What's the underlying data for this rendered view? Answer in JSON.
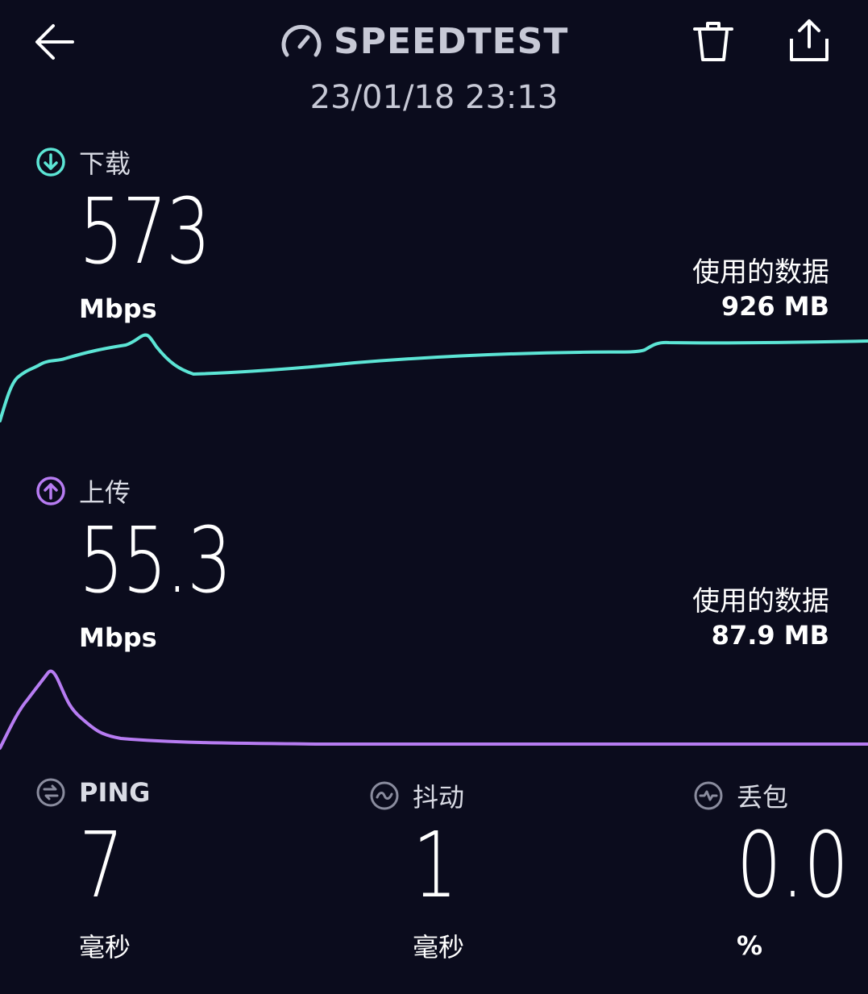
{
  "header": {
    "brand": "SPEEDTEST",
    "datetime": "23/01/18 23:13",
    "icons": {
      "back": "arrow-left-icon",
      "brand": "speedometer-icon",
      "delete": "trash-icon",
      "share": "share-icon"
    }
  },
  "download": {
    "label": "下载",
    "value": "573",
    "unit": "Mbps",
    "data_used_label": "使用的数据",
    "data_used_value": "926 MB",
    "color": "#5ce5d5",
    "icon": "arrow-down-circle-icon"
  },
  "upload": {
    "label": "上传",
    "value": "55.3",
    "unit": "Mbps",
    "data_used_label": "使用的数据",
    "data_used_value": "87.9 MB",
    "color": "#b77cf2",
    "icon": "arrow-up-circle-icon"
  },
  "metrics": {
    "ping": {
      "label": "PING",
      "value": "7",
      "unit": "毫秒",
      "icon": "ping-icon"
    },
    "jitter": {
      "label": "抖动",
      "value": "1",
      "unit": "毫秒",
      "icon": "jitter-icon"
    },
    "loss": {
      "label": "丢包",
      "value": "0.0",
      "unit": "%",
      "icon": "packet-loss-icon"
    }
  }
}
